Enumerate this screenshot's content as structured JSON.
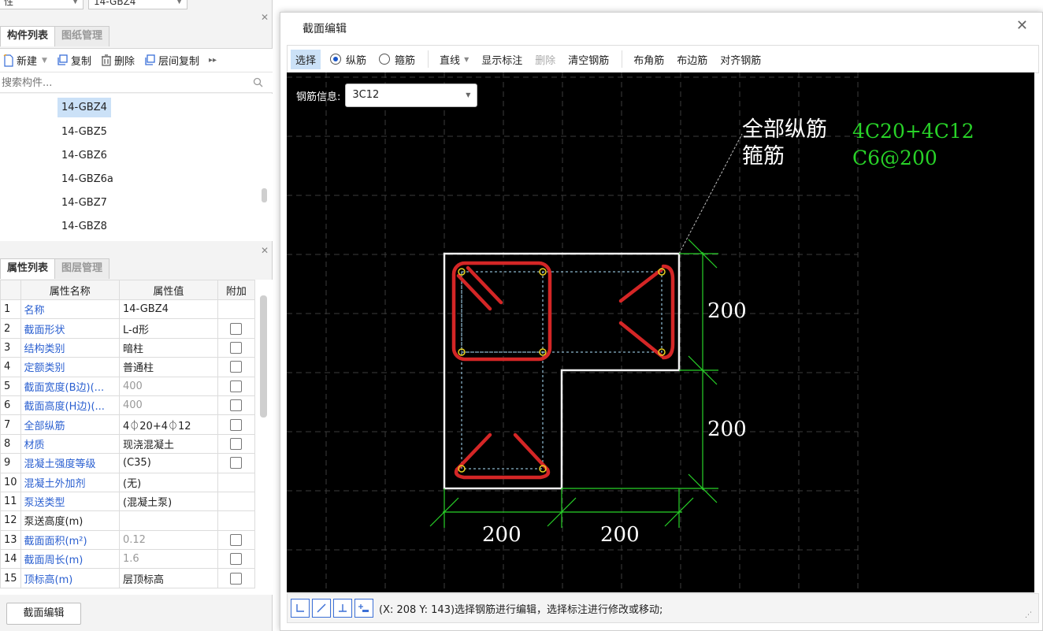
{
  "top_combos": {
    "left": "性",
    "right": "14-GBZ4"
  },
  "component_panel": {
    "tabs": [
      "构件列表",
      "图纸管理"
    ],
    "toolbar": {
      "new": "新建",
      "copy": "复制",
      "delete": "删除",
      "floor_copy": "层间复制"
    },
    "search_placeholder": "搜索构件...",
    "items": [
      "14-GBZ4",
      "14-GBZ5",
      "14-GBZ6",
      "14-GBZ6a",
      "14-GBZ7",
      "14-GBZ8"
    ],
    "selected_index": 0
  },
  "property_panel": {
    "tabs": [
      "属性列表",
      "图层管理"
    ],
    "headers": [
      "属性名称",
      "属性值",
      "附加"
    ],
    "rows": [
      {
        "no": "1",
        "name": "名称",
        "value": "14-GBZ4"
      },
      {
        "no": "2",
        "name": "截面形状",
        "value": "L-d形"
      },
      {
        "no": "3",
        "name": "结构类别",
        "value": "暗柱"
      },
      {
        "no": "4",
        "name": "定额类别",
        "value": "普通柱"
      },
      {
        "no": "5",
        "name": "截面宽度(B边)(...",
        "value": "400"
      },
      {
        "no": "6",
        "name": "截面高度(H边)(...",
        "value": "400"
      },
      {
        "no": "7",
        "name": "全部纵筋",
        "value": "4⏀20+4⏀12"
      },
      {
        "no": "8",
        "name": "材质",
        "value": "现浇混凝土"
      },
      {
        "no": "9",
        "name": "混凝土强度等级",
        "value": "(C35)"
      },
      {
        "no": "10",
        "name": "混凝土外加剂",
        "value": "(无)"
      },
      {
        "no": "11",
        "name": "泵送类型",
        "value": "(混凝土泵)"
      },
      {
        "no": "12",
        "name": "泵送高度(m)",
        "value": ""
      },
      {
        "no": "13",
        "name": "截面面积(m²)",
        "value": "0.12"
      },
      {
        "no": "14",
        "name": "截面周长(m)",
        "value": "1.6"
      },
      {
        "no": "15",
        "name": "顶标高(m)",
        "value": "层顶标高"
      }
    ],
    "section_edit_button": "截面编辑"
  },
  "dialog": {
    "title": "截面编辑",
    "toolbar": {
      "select": "选择",
      "longitudinal": "纵筋",
      "stirrup": "箍筋",
      "line": "直线",
      "show_dim": "显示标注",
      "delete": "删除",
      "clear": "清空钢筋",
      "corner": "布角筋",
      "edge": "布边筋",
      "align": "对齐钢筋"
    },
    "rebar_info_label": "钢筋信息:",
    "rebar_info_value": "3C12",
    "annotation": {
      "label1": "全部纵筋",
      "value1": "4C20+4C12",
      "label2": "箍筋",
      "value2": "C6@200"
    },
    "dimensions": {
      "right_top": "200",
      "right_bottom": "200",
      "bottom_left": "200",
      "bottom_right": "200"
    },
    "status_text": "(X: 208 Y: 143)选择钢筋进行编辑，选择标注进行修改或移动;"
  },
  "colors": {
    "accent": "#1a56c8",
    "rebar": "#e03030",
    "dimension": "#28d228",
    "canvas_bg": "#000000"
  }
}
